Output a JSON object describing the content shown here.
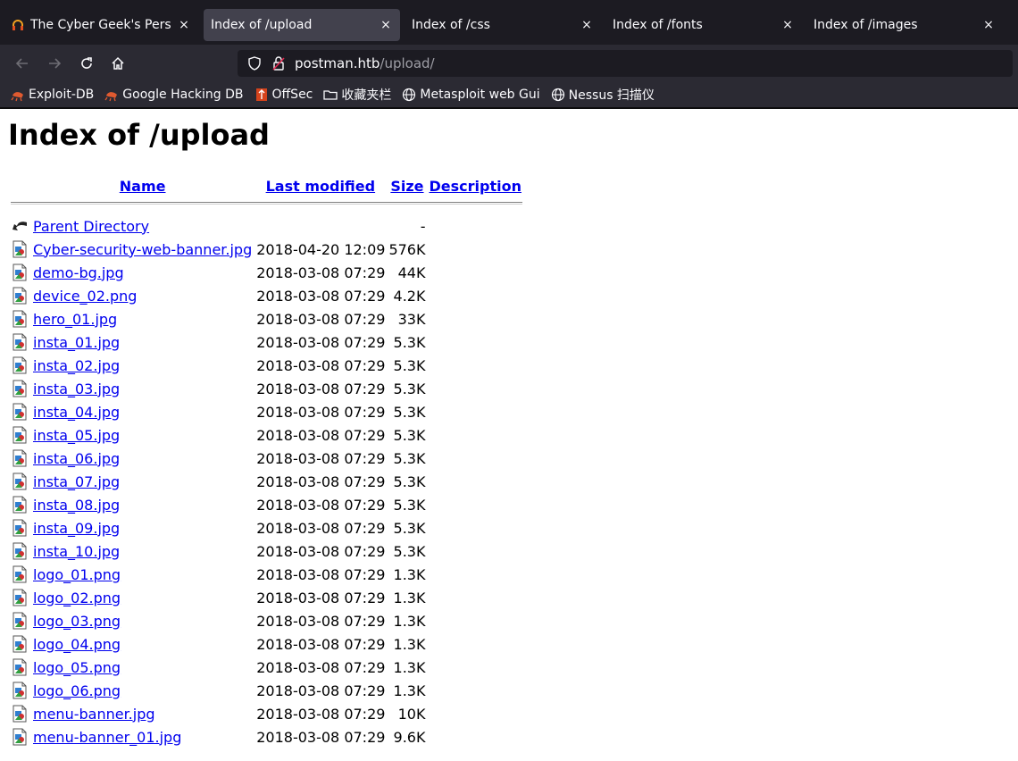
{
  "browser": {
    "tabs": [
      {
        "title": "The Cyber Geek's Persona",
        "icon": "headphones-icon",
        "active": false
      },
      {
        "title": "Index of /upload",
        "icon": "",
        "active": true
      },
      {
        "title": "Index of /css",
        "icon": "",
        "active": false
      },
      {
        "title": "Index of /fonts",
        "icon": "",
        "active": false
      },
      {
        "title": "Index of /images",
        "icon": "",
        "active": false
      }
    ],
    "close_glyph": "×",
    "url": {
      "host": "postman.htb",
      "path": "/upload/"
    },
    "bookmarks": [
      {
        "label": "Exploit-DB",
        "icon": "exploitdb-icon"
      },
      {
        "label": "Google Hacking DB",
        "icon": "ghdb-icon"
      },
      {
        "label": "OffSec",
        "icon": "offsec-icon"
      },
      {
        "label": "收藏夹栏",
        "icon": "folder-icon"
      },
      {
        "label": "Metasploit web Gui",
        "icon": "globe-icon"
      },
      {
        "label": "Nessus 扫描仪",
        "icon": "globe-icon"
      }
    ]
  },
  "page": {
    "heading": "Index of /upload",
    "columns": {
      "name": "Name",
      "last_modified": "Last modified",
      "size": "Size",
      "description": "Description"
    },
    "parent": {
      "name": "Parent Directory",
      "size": "-"
    },
    "files": [
      {
        "name": "Cyber-security-web-banner.jpg",
        "modified": "2018-04-20 12:09",
        "size": "576K"
      },
      {
        "name": "demo-bg.jpg",
        "modified": "2018-03-08 07:29",
        "size": "44K"
      },
      {
        "name": "device_02.png",
        "modified": "2018-03-08 07:29",
        "size": "4.2K"
      },
      {
        "name": "hero_01.jpg",
        "modified": "2018-03-08 07:29",
        "size": "33K"
      },
      {
        "name": "insta_01.jpg",
        "modified": "2018-03-08 07:29",
        "size": "5.3K"
      },
      {
        "name": "insta_02.jpg",
        "modified": "2018-03-08 07:29",
        "size": "5.3K"
      },
      {
        "name": "insta_03.jpg",
        "modified": "2018-03-08 07:29",
        "size": "5.3K"
      },
      {
        "name": "insta_04.jpg",
        "modified": "2018-03-08 07:29",
        "size": "5.3K"
      },
      {
        "name": "insta_05.jpg",
        "modified": "2018-03-08 07:29",
        "size": "5.3K"
      },
      {
        "name": "insta_06.jpg",
        "modified": "2018-03-08 07:29",
        "size": "5.3K"
      },
      {
        "name": "insta_07.jpg",
        "modified": "2018-03-08 07:29",
        "size": "5.3K"
      },
      {
        "name": "insta_08.jpg",
        "modified": "2018-03-08 07:29",
        "size": "5.3K"
      },
      {
        "name": "insta_09.jpg",
        "modified": "2018-03-08 07:29",
        "size": "5.3K"
      },
      {
        "name": "insta_10.jpg",
        "modified": "2018-03-08 07:29",
        "size": "5.3K"
      },
      {
        "name": "logo_01.png",
        "modified": "2018-03-08 07:29",
        "size": "1.3K"
      },
      {
        "name": "logo_02.png",
        "modified": "2018-03-08 07:29",
        "size": "1.3K"
      },
      {
        "name": "logo_03.png",
        "modified": "2018-03-08 07:29",
        "size": "1.3K"
      },
      {
        "name": "logo_04.png",
        "modified": "2018-03-08 07:29",
        "size": "1.3K"
      },
      {
        "name": "logo_05.png",
        "modified": "2018-03-08 07:29",
        "size": "1.3K"
      },
      {
        "name": "logo_06.png",
        "modified": "2018-03-08 07:29",
        "size": "1.3K"
      },
      {
        "name": "menu-banner.jpg",
        "modified": "2018-03-08 07:29",
        "size": "10K"
      },
      {
        "name": "menu-banner_01.jpg",
        "modified": "2018-03-08 07:29",
        "size": "9.6K"
      }
    ]
  },
  "colors": {
    "link": "#0000ee",
    "chrome_dark": "#1c1b22",
    "toolbar": "#2b2a33",
    "active_tab": "#42414d"
  }
}
